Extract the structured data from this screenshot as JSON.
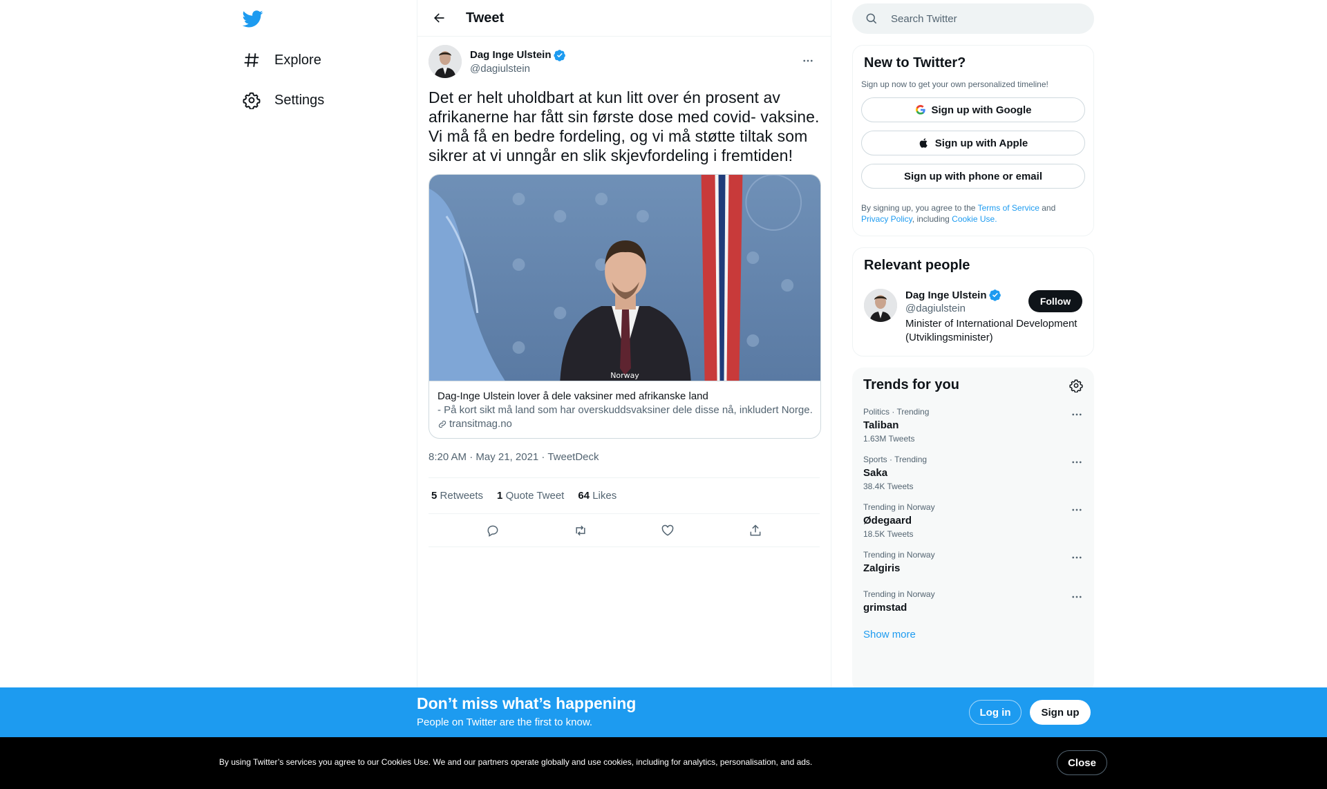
{
  "nav": {
    "items": [
      {
        "label": "Explore",
        "icon": "hashtag-icon"
      },
      {
        "label": "Settings",
        "icon": "gear-icon"
      }
    ]
  },
  "header": {
    "title": "Tweet"
  },
  "tweet": {
    "author_name": "Dag Inge Ulstein",
    "author_handle": "@dagiulstein",
    "text": "Det er helt uholdbart at kun litt over én prosent av afrikanerne har fått sin første dose med covid- vaksine. Vi må få en bedre fordeling, og vi må støtte tiltak som sikrer at vi unngår en slik skjevfordeling i fremtiden!",
    "card": {
      "image_caption": "Norway",
      "title": "Dag-Inge Ulstein lover å dele vaksiner med afrikanske land",
      "description": "- På kort sikt må land som har overskuddsvaksiner dele disse nå, inkludert Norge.",
      "domain": "transitmag.no"
    },
    "meta": "8:20 AM · May 21, 2021 · TweetDeck",
    "stats": [
      {
        "count": "5",
        "label": "Retweets"
      },
      {
        "count": "1",
        "label": "Quote Tweet"
      },
      {
        "count": "64",
        "label": "Likes"
      }
    ]
  },
  "search": {
    "placeholder": "Search Twitter"
  },
  "new_to_twitter": {
    "title": "New to Twitter?",
    "subtitle": "Sign up now to get your own personalized timeline!",
    "google": "Sign up with Google",
    "apple": "Sign up with Apple",
    "phone": "Sign up with phone or email",
    "terms_prefix": "By signing up, you agree to the ",
    "terms_link": "Terms of Service",
    "terms_and": " and",
    "privacy_link": "Privacy Policy",
    "terms_including": ", including ",
    "cookie_link": "Cookie Use."
  },
  "relevant": {
    "title": "Relevant people",
    "name": "Dag Inge Ulstein",
    "handle": "@dagiulstein",
    "bio": "Minister of International Development (Utviklingsminister)",
    "follow": "Follow"
  },
  "trends": {
    "title": "Trends for you",
    "items": [
      {
        "meta": "Politics · Trending",
        "name": "Taliban",
        "count": "1.63M Tweets"
      },
      {
        "meta": "Sports · Trending",
        "name": "Saka",
        "count": "38.4K Tweets"
      },
      {
        "meta": "Trending in Norway",
        "name": "Ødegaard",
        "count": "18.5K Tweets"
      },
      {
        "meta": "Trending in Norway",
        "name": "Zalgiris",
        "count": ""
      },
      {
        "meta": "Trending in Norway",
        "name": "grimstad",
        "count": ""
      }
    ],
    "show_more": "Show more"
  },
  "bottom_bar": {
    "title": "Don’t miss what’s happening",
    "subtitle": "People on Twitter are the first to know.",
    "login": "Log in",
    "signup": "Sign up"
  },
  "cookie_bar": {
    "text": "By using Twitter’s services you agree to our Cookies Use. We and our partners operate globally and use cookies, including for analytics, personalisation, and ads.",
    "close": "Close"
  },
  "colors": {
    "accent": "#1d9bf0",
    "text": "#0f1419",
    "secondary": "#536471",
    "border": "#eff3f4"
  }
}
